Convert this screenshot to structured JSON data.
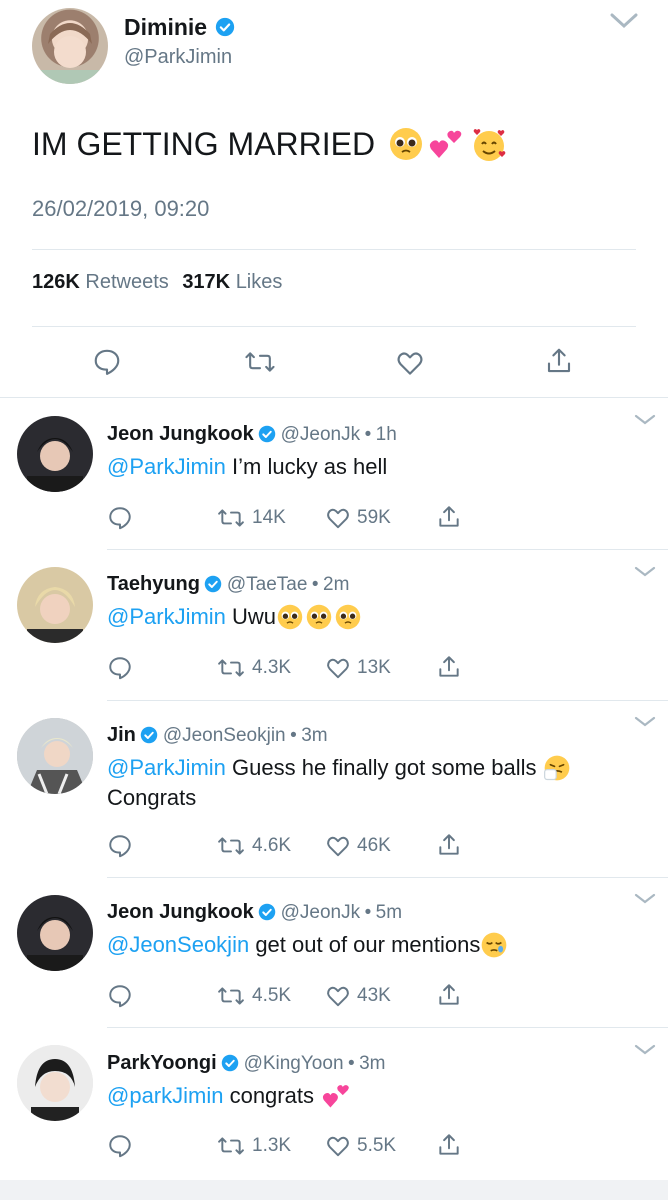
{
  "main_tweet": {
    "display_name": "Diminie",
    "handle": "@ParkJimin",
    "text": "IM GETTING MARRIED",
    "timestamp": "26/02/2019, 09:20",
    "retweets_count": "126K",
    "retweets_label": "Retweets",
    "likes_count": "317K",
    "likes_label": "Likes"
  },
  "replies": [
    {
      "display_name": "Jeon Jungkook",
      "handle": "@JeonJk",
      "time": "1h",
      "mention": "@ParkJimin",
      "text": " I’m lucky as hell",
      "text_line2": "",
      "retweets": "14K",
      "likes": "59K"
    },
    {
      "display_name": "Taehyung",
      "handle": "@TaeTae",
      "time": "2m",
      "mention": "@ParkJimin",
      "text": " Uwu",
      "text_line2": "",
      "retweets": "4.3K",
      "likes": "13K"
    },
    {
      "display_name": "Jin",
      "handle": "@JeonSeokjin",
      "time": "3m",
      "mention": "@ParkJimin",
      "text": " Guess he finally got some balls",
      "text_line2": "Congrats",
      "retweets": "4.6K",
      "likes": "46K"
    },
    {
      "display_name": "Jeon Jungkook",
      "handle": "@JeonJk",
      "time": "5m",
      "mention": "@JeonSeokjin",
      "text": " get out of our mentions",
      "text_line2": "",
      "retweets": "4.5K",
      "likes": "43K"
    },
    {
      "display_name": "ParkYoongi",
      "handle": "@KingYoon",
      "time": "3m",
      "mention": "@parkJimin",
      "text": " congrats",
      "text_line2": "",
      "retweets": "1.3K",
      "likes": "5.5K"
    }
  ],
  "separator": "•",
  "colors": {
    "accent": "#1da1f2",
    "muted": "#657786",
    "divider": "#e1e8ed",
    "text": "#14171a"
  }
}
